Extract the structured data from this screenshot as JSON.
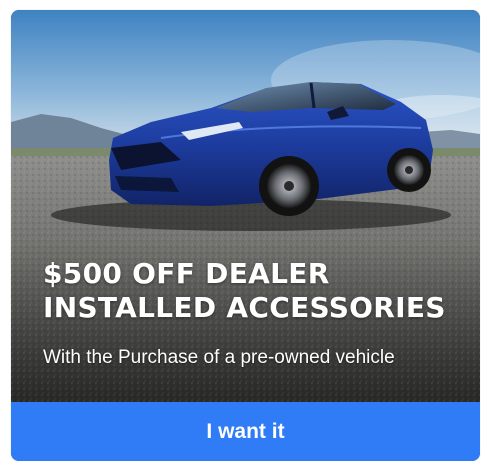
{
  "promo": {
    "headline_line1": "$500 OFF DEALER",
    "headline_line2": "INSTALLED ACCESSORIES",
    "subline": "With the Purchase of a pre-owned vehicle",
    "cta_label": "I want it"
  },
  "colors": {
    "cta_background": "#2f7cf6",
    "car_body": "#1f3fa8",
    "text": "#ffffff"
  }
}
